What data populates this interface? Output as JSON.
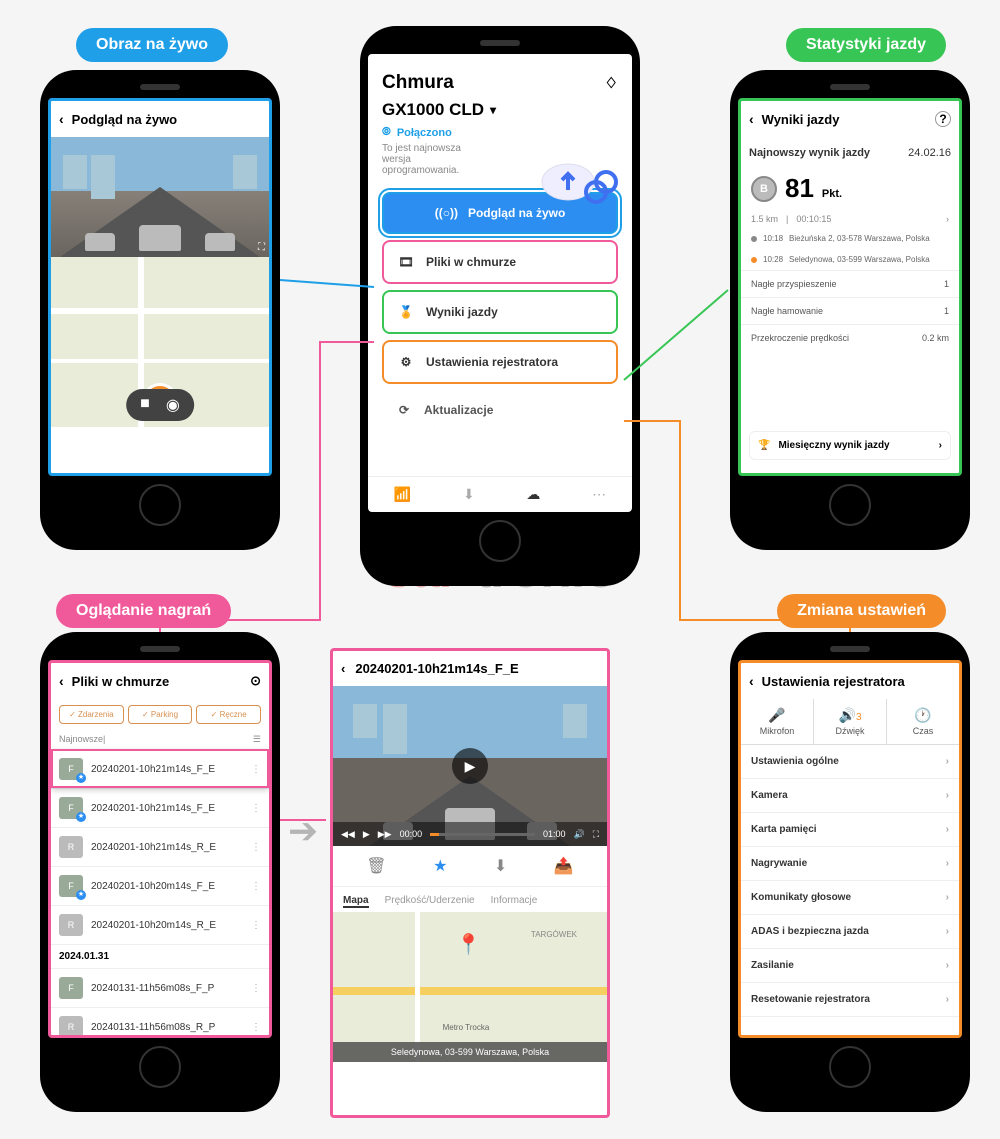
{
  "labels": {
    "live_view": "Obraz na żywo",
    "driving_stats": "Statystyki jazdy",
    "watching_recordings": "Oglądanie nagrań",
    "change_settings": "Zmiana ustawień"
  },
  "watermark": {
    "part1": "car",
    "part2": "-tronic"
  },
  "phone_live": {
    "title": "Podgląd na żywo"
  },
  "phone_cloud": {
    "title": "Chmura",
    "device": "GX1000 CLD",
    "status": "Połączono",
    "status_desc": "To jest najnowsza wersja oprogramowania.",
    "menu": {
      "live": "Podgląd na żywo",
      "files": "Pliki w chmurze",
      "scores": "Wyniki jazdy",
      "settings": "Ustawienia rejestratora",
      "updates": "Aktualizacje"
    }
  },
  "phone_stats": {
    "title": "Wyniki jazdy",
    "latest_label": "Najnowszy wynik jazdy",
    "latest_date": "24.02.16",
    "grade": "B",
    "score": "81",
    "unit": "Pkt.",
    "distance": "1.5 km",
    "duration": "00:10:15",
    "start_time": "10:18",
    "start_addr": "Bieżuńska 2, 03-578 Warszawa, Polska",
    "end_time": "10:28",
    "end_addr": "Seledynowa, 03-599 Warszawa, Polska",
    "rows": [
      {
        "label": "Nagłe przyspieszenie",
        "value": "1"
      },
      {
        "label": "Nagłe hamowanie",
        "value": "1"
      },
      {
        "label": "Przekroczenie prędkości",
        "value": "0.2 km"
      }
    ],
    "monthly": "Miesięczny wynik jazdy"
  },
  "phone_files": {
    "title": "Pliki w chmurze",
    "filters": [
      "Zdarzenia",
      "Parking",
      "Ręczne"
    ],
    "sort": "Najnowsze",
    "items": [
      {
        "name": "20240201-10h21m14s_F_E",
        "type": "F",
        "star": true
      },
      {
        "name": "20240201-10h21m14s_F_E",
        "type": "F",
        "star": true
      },
      {
        "name": "20240201-10h21m14s_R_E",
        "type": "R",
        "star": false
      },
      {
        "name": "20240201-10h20m14s_F_E",
        "type": "F",
        "star": true
      },
      {
        "name": "20240201-10h20m14s_R_E",
        "type": "R",
        "star": false
      }
    ],
    "date_sep": "2024.01.31",
    "items2": [
      {
        "name": "20240131-11h56m08s_F_P",
        "type": "F",
        "star": false
      },
      {
        "name": "20240131-11h56m08s_R_P",
        "type": "R",
        "star": false
      }
    ]
  },
  "phone_video": {
    "title": "20240201-10h21m14s_F_E",
    "time_cur": "00:00",
    "time_total": "01:00",
    "tabs": [
      "Mapa",
      "Prędkość/Uderzenie",
      "Informacje"
    ],
    "address": "Seledynowa, 03-599 Warszawa, Polska",
    "map_label": "TARGÓWEK",
    "map_metro": "Metro Trocka"
  },
  "phone_settings": {
    "title": "Ustawienia rejestratora",
    "quick": [
      {
        "icon": "mic",
        "label": "Mikrofon"
      },
      {
        "icon": "vol",
        "label": "Dźwięk",
        "badge": "3"
      },
      {
        "icon": "clock",
        "label": "Czas"
      }
    ],
    "rows": [
      "Ustawienia ogólne",
      "Kamera",
      "Karta pamięci",
      "Nagrywanie",
      "Komunikaty głosowe",
      "ADAS i bezpieczna jazda",
      "Zasilanie",
      "Resetowanie rejestratora"
    ]
  }
}
